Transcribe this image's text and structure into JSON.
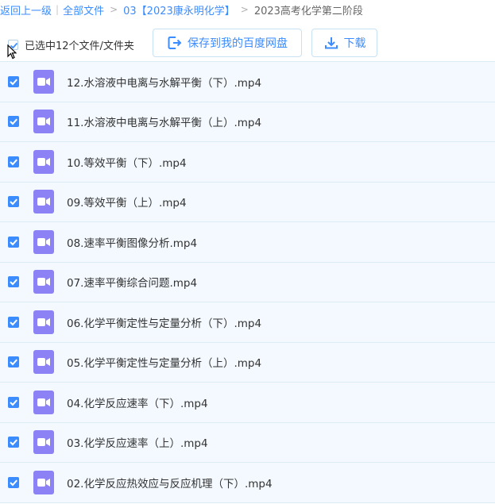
{
  "breadcrumb": {
    "back": "返回上一级",
    "all_files": "全部文件",
    "folder": "03【2023康永明化学】",
    "current": "2023高考化学第二阶段"
  },
  "toolbar": {
    "selected_label": "已选中12个文件/文件夹",
    "save_label": "保存到我的百度网盘",
    "download_label": "下载"
  },
  "files": [
    {
      "name": "12.水溶液中电离与水解平衡（下）.mp4",
      "checked": true,
      "icon": "video-file-icon"
    },
    {
      "name": "11.水溶液中电离与水解平衡（上）.mp4",
      "checked": true,
      "icon": "video-file-icon"
    },
    {
      "name": "10.等效平衡（下）.mp4",
      "checked": true,
      "icon": "video-file-icon"
    },
    {
      "name": "09.等效平衡（上）.mp4",
      "checked": true,
      "icon": "video-file-icon"
    },
    {
      "name": "08.速率平衡图像分析.mp4",
      "checked": true,
      "icon": "video-file-icon"
    },
    {
      "name": "07.速率平衡综合问题.mp4",
      "checked": true,
      "icon": "video-file-icon"
    },
    {
      "name": "06.化学平衡定性与定量分析（下）.mp4",
      "checked": true,
      "icon": "video-file-icon"
    },
    {
      "name": "05.化学平衡定性与定量分析（上）.mp4",
      "checked": true,
      "icon": "video-file-icon"
    },
    {
      "name": "04.化学反应速率（下）.mp4",
      "checked": true,
      "icon": "video-file-icon"
    },
    {
      "name": "03.化学反应速率（上）.mp4",
      "checked": true,
      "icon": "video-file-icon"
    },
    {
      "name": "02.化学反应热效应与反应机理（下）.mp4",
      "checked": true,
      "icon": "video-file-icon"
    }
  ],
  "colors": {
    "accent": "#3b8cff",
    "video_icon": "#8c82f5",
    "row_bg": "#f3f9fe"
  }
}
